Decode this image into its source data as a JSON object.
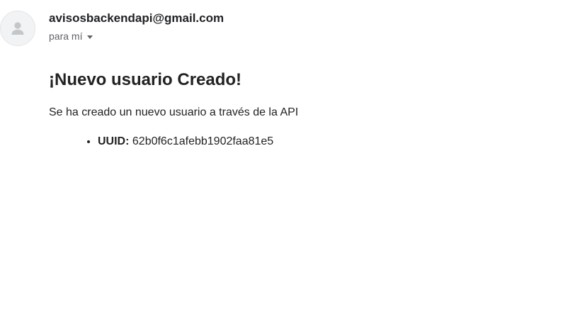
{
  "email": {
    "sender": "avisosbackendapi@gmail.com",
    "recipient": "para mí",
    "heading": "¡Nuevo usuario Creado!",
    "body_text": "Se ha creado un nuevo usuario a través de la API",
    "details": [
      {
        "label": "UUID:",
        "value": "62b0f6c1afebb1902faa81e5"
      }
    ]
  },
  "icons": {
    "avatar": "person-silhouette-icon",
    "recipient_toggle": "chevron-down-icon"
  },
  "colors": {
    "sender": "#202124",
    "secondary_text": "#5f6368",
    "avatar_bg": "#f1f3f4",
    "avatar_figure": "#c4c7c9",
    "body_text": "#222222"
  }
}
